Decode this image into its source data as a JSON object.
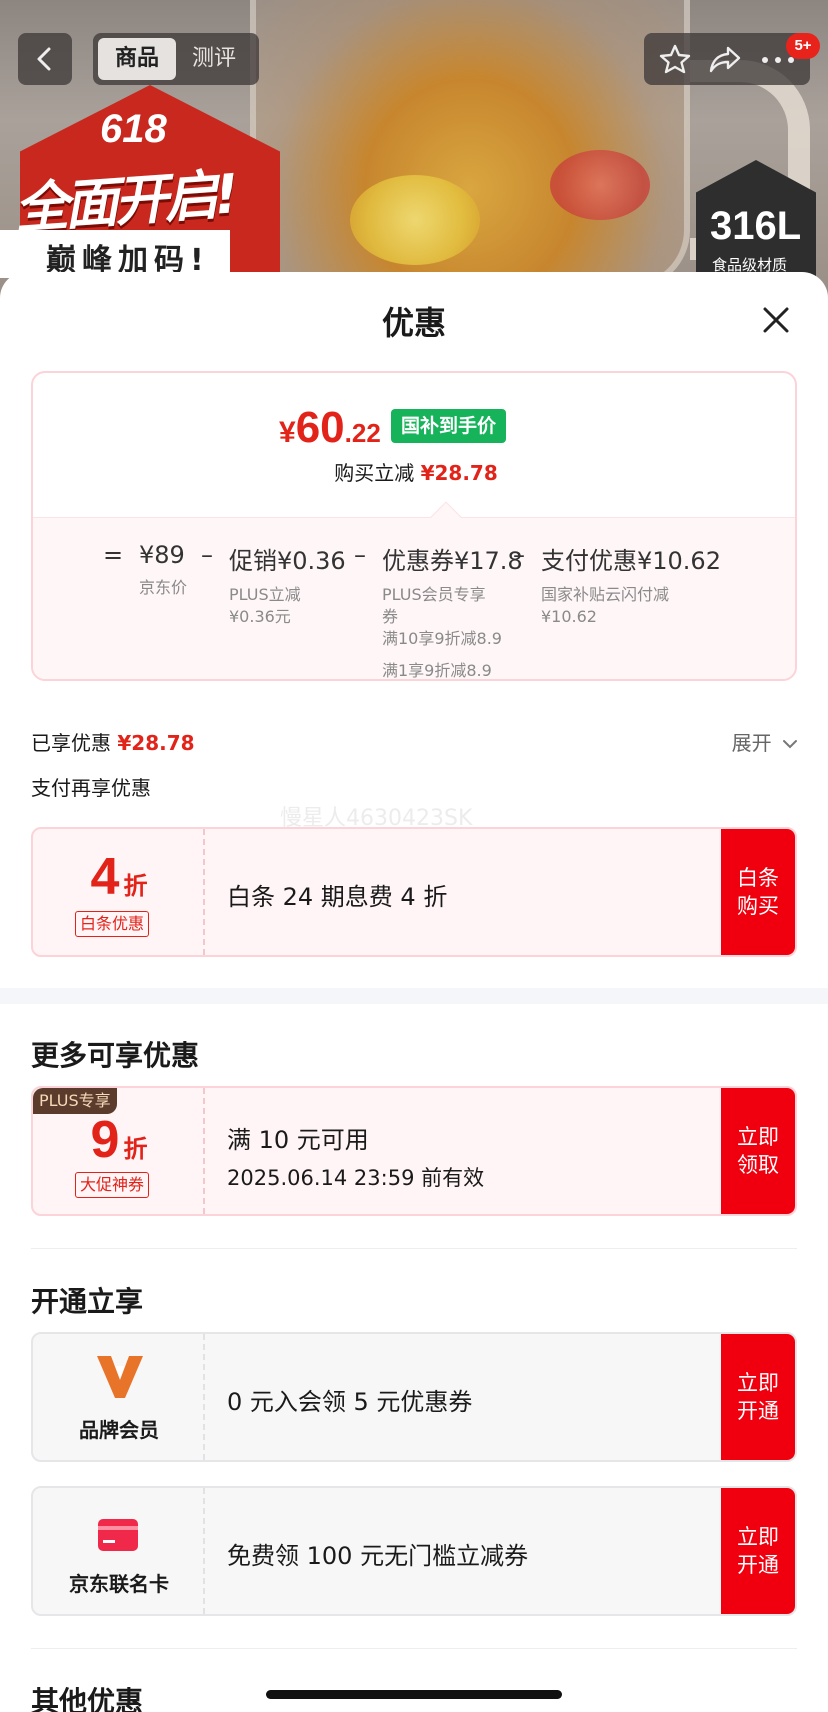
{
  "background": {
    "promo": {
      "top": "618",
      "title": "全面开启!",
      "subtitle": "巅峰加码!"
    },
    "material_badge": {
      "value": "316L",
      "label": "食品级材质"
    }
  },
  "topbar": {
    "tabs": [
      {
        "label": "商品",
        "active": true
      },
      {
        "label": "测评",
        "active": false
      }
    ],
    "notification_count": "5+"
  },
  "sheet": {
    "title": "优惠",
    "final_price": {
      "currency": "¥",
      "integer": "60",
      "decimal": ".22",
      "tag": "国补到手价"
    },
    "saving": {
      "label": "购买立减",
      "value": "¥28.78"
    },
    "breakdown": [
      {
        "op": "=",
        "main": "¥89",
        "sub": [
          "京东价"
        ]
      },
      {
        "op": "–",
        "main": "促销¥0.36",
        "sub": [
          "PLUS立减",
          "¥0.36元"
        ]
      },
      {
        "op": "–",
        "main": "优惠券¥17.8",
        "sub": [
          "PLUS会员专享",
          "券",
          "满10享9折减8.9"
        ],
        "extra": "满1享9折减8.9"
      },
      {
        "op": "–",
        "main": "支付优惠¥10.62",
        "sub": [
          "国家补贴云闪付减",
          "¥10.62"
        ]
      }
    ],
    "enjoyed": {
      "label": "已享优惠",
      "value": "¥28.78"
    },
    "expand_label": "展开",
    "pay_more_label": "支付再享优惠",
    "watermark": "慢星人4630423SK",
    "baitiao": {
      "number": "4",
      "unit": "折",
      "tag": "白条优惠",
      "desc": "白条 24 期息费 4 折",
      "cta": [
        "白条",
        "购买"
      ]
    },
    "more_title": "更多可享优惠",
    "plus_coupon": {
      "badge": "PLUS专享",
      "number": "9",
      "unit": "折",
      "tag": "大促神券",
      "line1": "满 10 元可用",
      "line2": "2025.06.14 23:59 前有效",
      "cta": [
        "立即",
        "领取"
      ]
    },
    "open_title": "开通立享",
    "brand_member": {
      "name": "品牌会员",
      "desc": "0 元入会领 5 元优惠券",
      "cta": [
        "立即",
        "开通"
      ]
    },
    "jd_card": {
      "name": "京东联名卡",
      "desc": "免费领 100 元无门槛立减券",
      "cta": [
        "立即",
        "开通"
      ]
    },
    "other_title": "其他优惠"
  },
  "colors": {
    "accent_red": "#e2231a",
    "cta_red": "#f0000f",
    "gov_green": "#17b35a"
  }
}
